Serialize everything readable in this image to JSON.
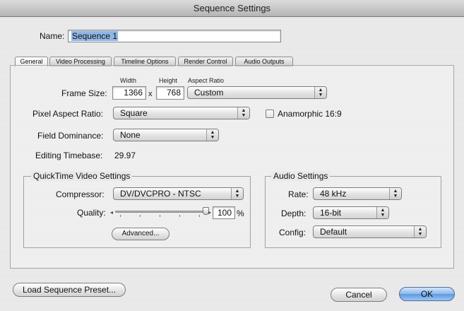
{
  "window": {
    "title": "Sequence Settings"
  },
  "name": {
    "label": "Name:",
    "value": "Sequence 1"
  },
  "tabs": [
    {
      "label": "General",
      "active": true
    },
    {
      "label": "Video Processing",
      "active": false
    },
    {
      "label": "Timeline Options",
      "active": false
    },
    {
      "label": "Render Control",
      "active": false
    },
    {
      "label": "Audio Outputs",
      "active": false
    }
  ],
  "general": {
    "headers": {
      "width": "Width",
      "height": "Height",
      "aspect": "Aspect Ratio"
    },
    "frame_size": {
      "label": "Frame Size:",
      "width": "1366",
      "x": "x",
      "height": "768",
      "aspect": "Custom"
    },
    "pixel_aspect": {
      "label": "Pixel Aspect Ratio:",
      "value": "Square"
    },
    "anamorphic": {
      "label": "Anamorphic 16:9",
      "checked": false
    },
    "field_dominance": {
      "label": "Field Dominance:",
      "value": "None"
    },
    "editing_timebase": {
      "label": "Editing Timebase:",
      "value": "29.97"
    }
  },
  "quicktime": {
    "title": "QuickTime Video Settings",
    "compressor": {
      "label": "Compressor:",
      "value": "DV/DVCPRO - NTSC"
    },
    "quality": {
      "label": "Quality:",
      "value": "100",
      "unit": "%",
      "level": 1.0
    },
    "advanced_label": "Advanced..."
  },
  "audio": {
    "title": "Audio Settings",
    "rate": {
      "label": "Rate:",
      "value": "48 kHz"
    },
    "depth": {
      "label": "Depth:",
      "value": "16-bit"
    },
    "config": {
      "label": "Config:",
      "value": "Default"
    }
  },
  "buttons": {
    "load_preset": "Load Sequence Preset...",
    "cancel": "Cancel",
    "ok": "OK"
  },
  "colors": {
    "default_button": "#6fa6e8",
    "selection": "#8fb6e6"
  }
}
